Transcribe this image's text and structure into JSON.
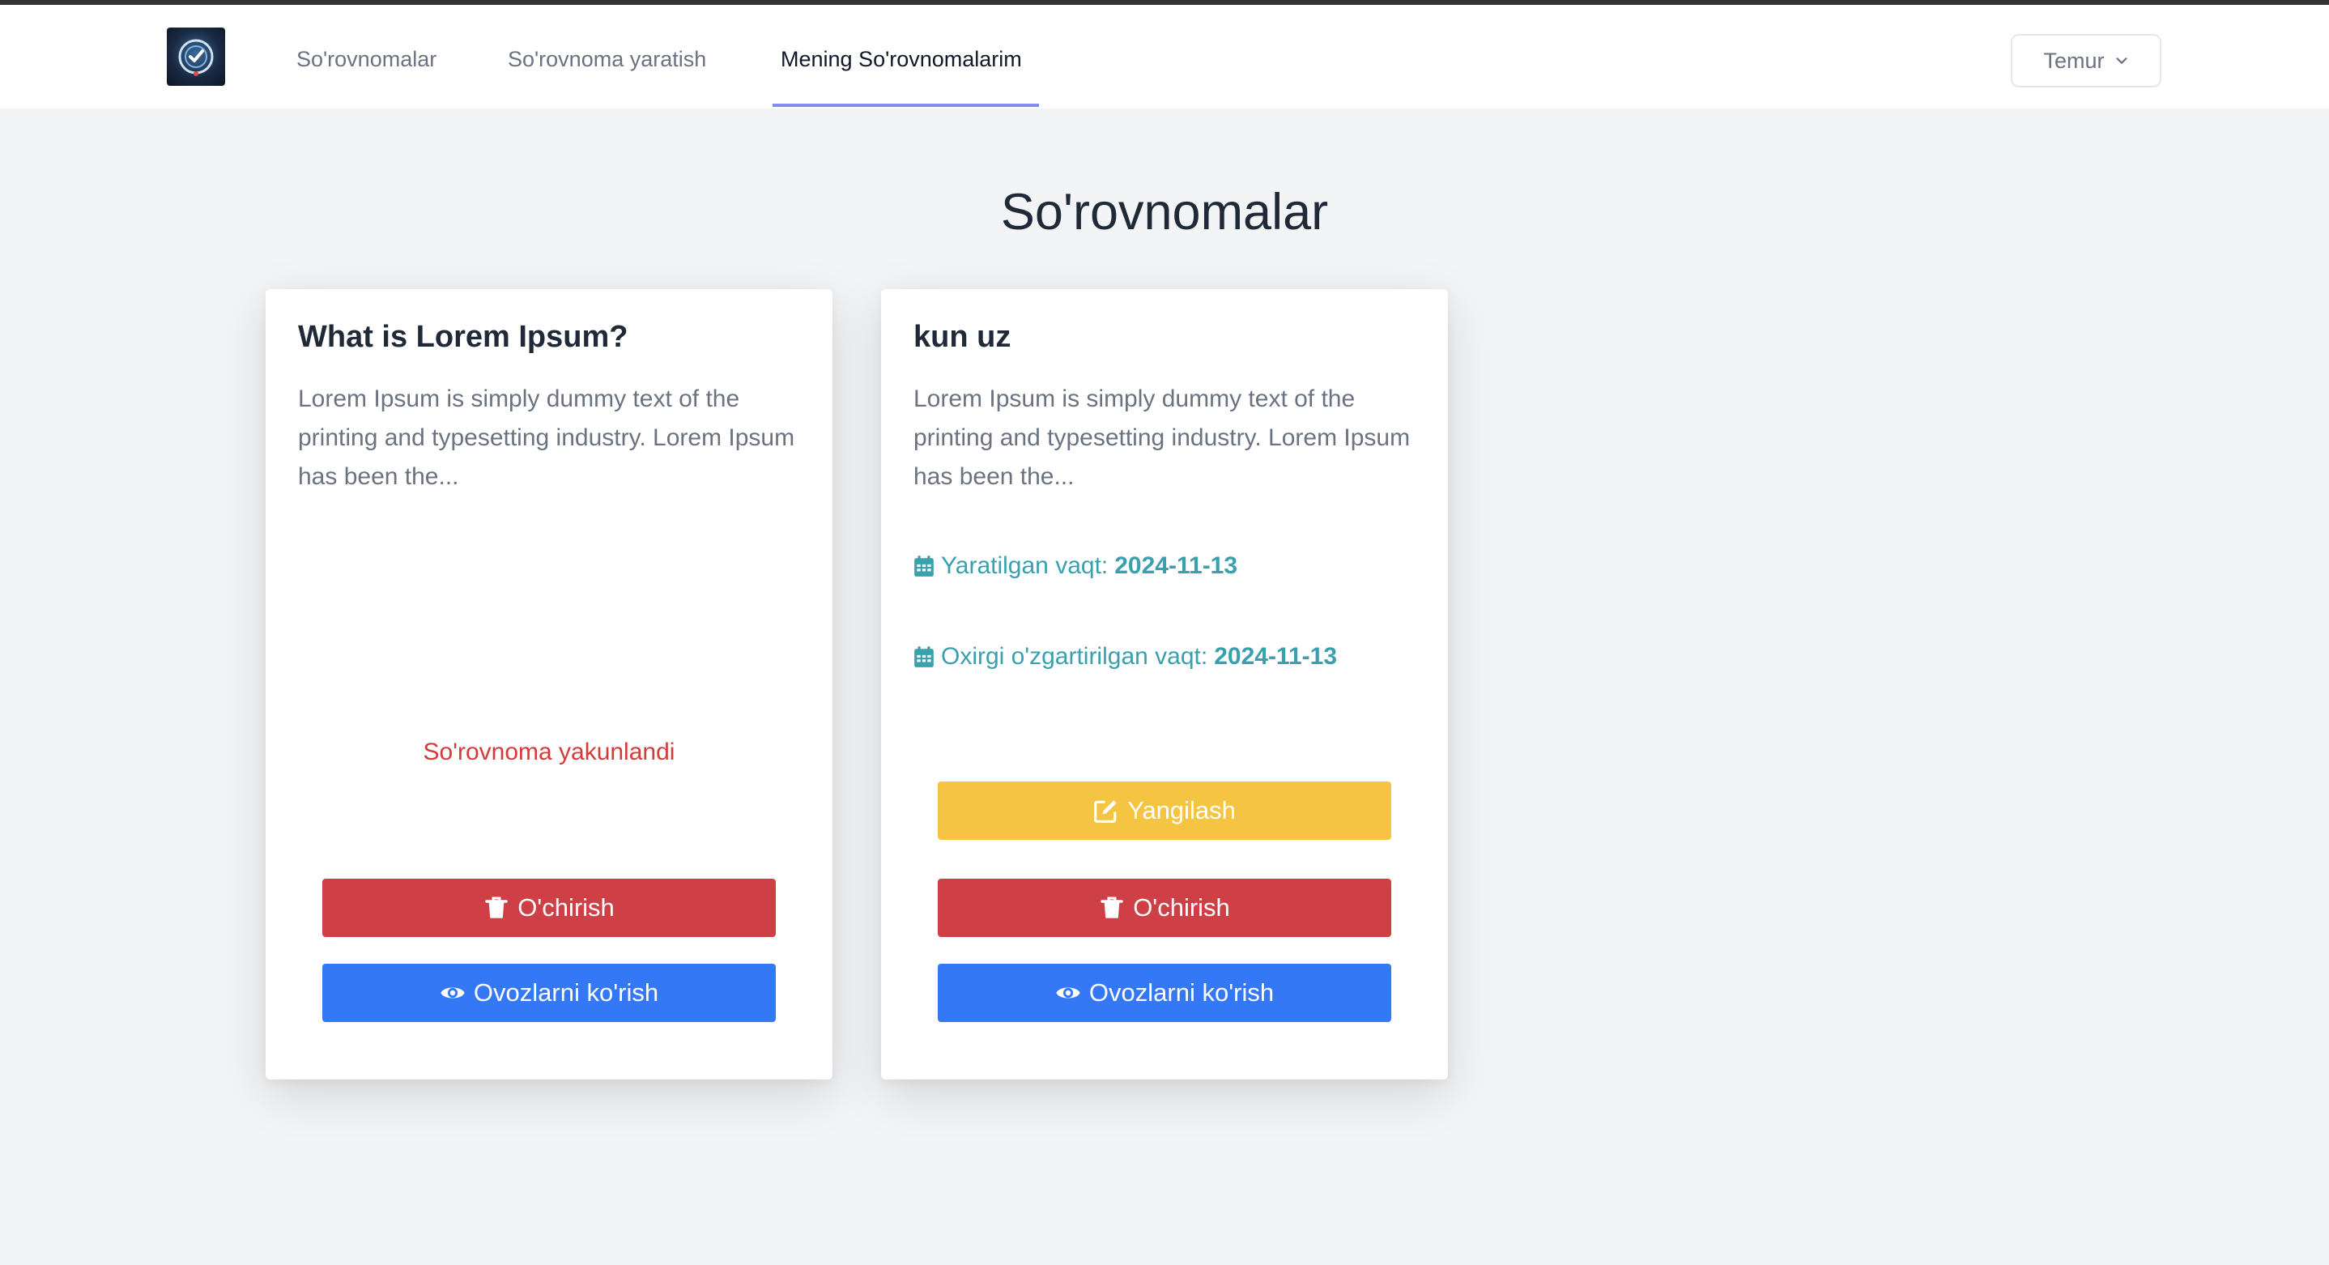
{
  "nav": {
    "links": [
      "So'rovnomalar",
      "So'rovnoma yaratish",
      "Mening So'rovnomalarim"
    ],
    "active_index": 2,
    "user": "Temur"
  },
  "page": {
    "title": "So'rovnomalar"
  },
  "cards": [
    {
      "title": "What is Lorem Ipsum?",
      "description": "Lorem Ipsum is simply dummy text of the printing and typesetting industry. Lorem Ipsum has been the...",
      "status": "So'rovnoma yakunlandi",
      "delete_label": "O'chirish",
      "votes_label": "Ovozlarni ko'rish"
    },
    {
      "title": "kun uz",
      "description": "Lorem Ipsum is simply dummy text of the printing and typesetting industry. Lorem Ipsum has been the...",
      "created_label": "Yaratilgan vaqt:",
      "created_date": "2024-11-13",
      "updated_label": "Oxirgi o'zgartirilgan vaqt:",
      "updated_date": "2024-11-13",
      "update_label": "Yangilash",
      "delete_label": "O'chirish",
      "votes_label": "Ovozlarni ko'rish"
    }
  ],
  "colors": {
    "accent_underline": "#818cf8",
    "danger": "#cf4046",
    "primary": "#3478f6",
    "warning": "#f5c443",
    "info_text": "#3aa0ae"
  },
  "icons": [
    "logo",
    "chevron-down-icon",
    "calendar-icon",
    "edit-icon",
    "trash-icon",
    "eye-icon"
  ]
}
